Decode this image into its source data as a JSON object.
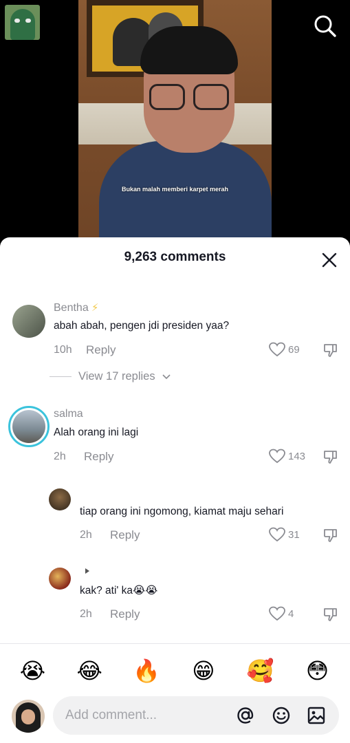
{
  "video": {
    "subtitle": "Bukan malah memberi karpet merah"
  },
  "topbar": {
    "search_icon": "search-icon"
  },
  "sheet": {
    "title": "9,263 comments",
    "close_icon": "close-icon"
  },
  "comments": [
    {
      "author": "Bentha",
      "text": "abah abah, pengen jdi presiden yaa?",
      "time": "10h",
      "reply_label": "Reply",
      "likes": "69",
      "view_replies": "View 17 replies"
    },
    {
      "author": "salma",
      "text": "Alah orang ini lagi",
      "time": "2h",
      "reply_label": "Reply",
      "likes": "143"
    }
  ],
  "replies": [
    {
      "text": "tiap orang ini ngomong, kiamat maju sehari",
      "time": "2h",
      "reply_label": "Reply",
      "likes": "31"
    },
    {
      "text": "kak? ati' ka😭😭",
      "time": "2h",
      "reply_label": "Reply",
      "likes": "4"
    }
  ],
  "emoji_bar": [
    "😭",
    "😂",
    "🔥",
    "😁",
    "🥰",
    "😳"
  ],
  "composer": {
    "placeholder": "Add comment..."
  },
  "colors": {
    "accent_ring": "#3bc3dc",
    "muted_text": "#8a8b91",
    "primary_text": "#161823"
  }
}
